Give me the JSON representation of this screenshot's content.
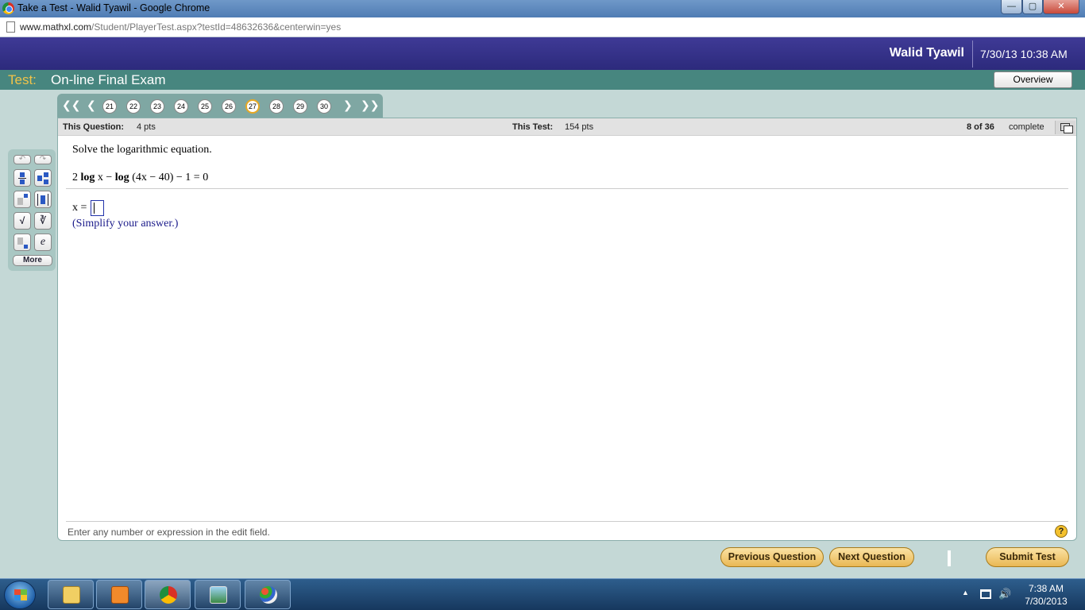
{
  "window": {
    "title": "Take a Test - Walid Tyawil - Google Chrome",
    "min_icon": "minimize-icon",
    "max_icon": "maximize-icon",
    "close_icon": "close-icon"
  },
  "address": {
    "domain": "www.mathxl.com",
    "path": "/Student/PlayerTest.aspx?testId=48632636&centerwin=yes"
  },
  "header": {
    "username": "Walid Tyawil",
    "datetime": "7/30/13 10:38 AM"
  },
  "test": {
    "label": "Test:",
    "name": "On-line Final Exam",
    "overview_label": "Overview"
  },
  "nav": {
    "first_icon": "double-chevron-left-icon",
    "prev_icon": "chevron-left-icon",
    "next_icon": "chevron-right-icon",
    "last_icon": "double-chevron-right-icon",
    "questions": [
      "21",
      "22",
      "23",
      "24",
      "25",
      "26",
      "27",
      "28",
      "29",
      "30"
    ],
    "current": "27"
  },
  "info": {
    "question_label": "This Question:",
    "question_value": "4 pts",
    "test_label": "This Test:",
    "test_value": "154 pts",
    "progress_count": "8 of 36",
    "progress_label": "complete"
  },
  "question": {
    "prompt": "Solve the logarithmic equation.",
    "eq_coef": "2 ",
    "eq_log1": "log",
    "eq_mid": " x −  ",
    "eq_log2": "log",
    "eq_rest": " (4x − 40) − 1 = 0",
    "answer_prefix": "x =",
    "answer_value": "",
    "hint": "(Simplify your answer.)"
  },
  "palette": {
    "undo_icon": "undo-icon",
    "redo_icon": "redo-icon",
    "fraction_icon": "fraction-icon",
    "mixed_number_icon": "mixed-number-icon",
    "exponent_icon": "exponent-icon",
    "absolute_value_icon": "absolute-value-icon",
    "sqrt_icon": "square-root-icon",
    "nth_root_icon": "nth-root-icon",
    "subscript_icon": "subscript-icon",
    "e_label": "e",
    "more_label": "More"
  },
  "status": {
    "text": "Enter any number or expression in the edit field.",
    "help_label": "?"
  },
  "buttons": {
    "previous": "Previous Question",
    "next": "Next Question",
    "submit": "Submit Test"
  },
  "taskbar": {
    "time": "7:38 AM",
    "date": "7/30/2013"
  }
}
